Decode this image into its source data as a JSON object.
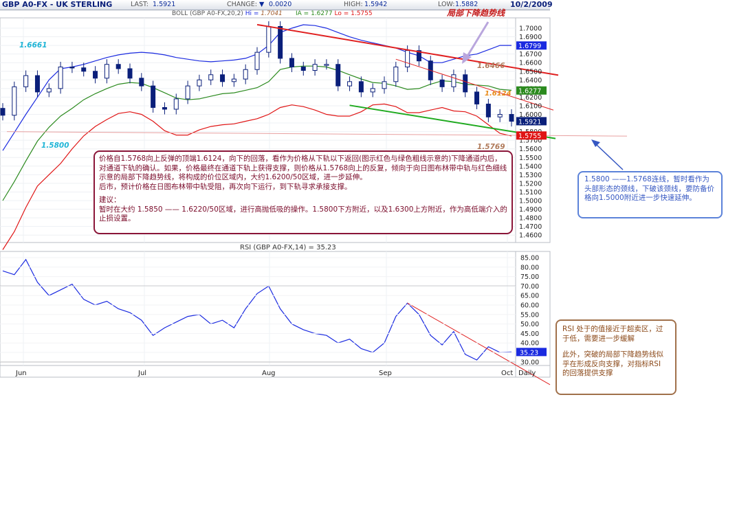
{
  "header": {
    "title": "GBP A0-FX - UK STERLING",
    "last_label": "LAST:",
    "last_value": "1.5921",
    "change_label": "CHANGE:",
    "change_arrow": "▼",
    "change_value": "0.0020",
    "high_label": "HIGH:",
    "high_value": "1.5942",
    "low_label": "LOW:",
    "low_value": "1.5882",
    "date": "10/2/2009"
  },
  "boll_legend": {
    "label": "BOLL (GBP A0-FX,20,2)",
    "hi_label": "Hi =",
    "hi_value": "1.7041",
    "ia_label": "IA =",
    "ia_value": "1.6277",
    "lo_label": "Lo =",
    "lo_value": "1.5755"
  },
  "rsi_legend": "RSI (GBP A0-FX,14) = 35.23",
  "colors": {
    "candle": "#0a1f7a",
    "upper_band": "#1a2ae0",
    "middle_band": "#2b8a1e",
    "lower_band": "#e01414",
    "trend_red": "#e02020",
    "trend_green": "#1faa1f",
    "rsi_line": "#1a2ae0",
    "annotation_title": "#c41a1a"
  },
  "chart_labels": {
    "annotation_title": "局部下降趋势线",
    "lvl_16661": "1.6661",
    "lvl_15800": "1.5800",
    "lvl_16466": "1.6466",
    "lvl_16124": "1.6124",
    "lvl_15769": "1.5769",
    "lvl_17041": "1.7041"
  },
  "tags": {
    "upper": "1.6799",
    "middle": "1.6277",
    "last": "1.5921",
    "lower": "1.5755",
    "rsi": "35.23"
  },
  "price_ticks": [
    "1.7000",
    "1.6900",
    "1.6800",
    "1.6700",
    "1.6600",
    "1.6500",
    "1.6400",
    "1.6300",
    "1.6200",
    "1.6100",
    "1.6000",
    "1.5900",
    "1.5800",
    "1.5700",
    "1.5600",
    "1.5500",
    "1.5400",
    "1.5300",
    "1.5200",
    "1.5100",
    "1.5000",
    "1.4900",
    "1.4800",
    "1.4700",
    "1.4600"
  ],
  "rsi_ticks": [
    "85.00",
    "80.00",
    "75.00",
    "70.00",
    "65.00",
    "60.00",
    "55.00",
    "50.00",
    "45.00",
    "40.00",
    "35.00",
    "30.00"
  ],
  "month_labels": [
    "Jun",
    "Jul",
    "Aug",
    "Sep",
    "Oct",
    "Daily"
  ],
  "annotations": {
    "main_p1": "价格自1.5768向上反弹的顶端1.6124，向下的回落，看作为价格从下轨以下返回(图示红色与绿色粗线示意的)下降通道内后，对通道下轨的确认。如果，价格最终在通道下轨上获得支撑，则价格从1.5768向上的反复，倾向于向日图布林带中轨与红色细线示意的局部下降趋势线，将构成的价位区域内，大约1.6200/50区域，进一步延伸。",
    "main_p2": "后市，预计价格在日图布林带中轨受阻，再次向下运行，到下轨寻求承接支撑。",
    "main_p3": "建议：",
    "main_p4": "暂时在大约 1.5850 —— 1.6220/50区域，进行高抛低吸的操作。1.5800下方附近，以及1.6300上方附近，作为高低端介入的止损设置。",
    "blue": "1.5800 ——1.5768连线，暂时看作为头部形态的颈线，下破该颈线，要防备价格向1.5000附近进一步快速延伸。",
    "brown_p1": "RSI 处于的值接近于超卖区，过于低，需要进一步缓解",
    "brown_p2": "此外，突破的局部下降趋势线似乎在形成反向支撑，对指标RSI 的回落提供支撑"
  },
  "chart_data": [
    {
      "type": "line",
      "title": "GBP A0-FX - UK STERLING",
      "subtitle": "BOLL (GBP A0-FX,20,2)",
      "x": [
        "Jun",
        "Jul",
        "Aug",
        "Sep",
        "Oct"
      ],
      "ylim": [
        1.455,
        1.705
      ],
      "series": [
        {
          "name": "Hi",
          "values": [
            1.558,
            1.579,
            1.6,
            1.62,
            1.64,
            1.653,
            1.655,
            1.658,
            1.662,
            1.666,
            1.669,
            1.671,
            1.672,
            1.671,
            1.669,
            1.666,
            1.664,
            1.662,
            1.661,
            1.662,
            1.663,
            1.665,
            1.67,
            1.68,
            1.695,
            1.7,
            1.704,
            1.703,
            1.7,
            1.695,
            1.69,
            1.686,
            1.683,
            1.68,
            1.677,
            1.672,
            1.668,
            1.66,
            1.66,
            1.664,
            1.668,
            1.67,
            1.675,
            1.68,
            1.68
          ]
        },
        {
          "name": "IA",
          "values": [
            1.5,
            1.522,
            1.546,
            1.569,
            1.585,
            1.598,
            1.607,
            1.617,
            1.624,
            1.63,
            1.635,
            1.637,
            1.636,
            1.631,
            1.625,
            1.619,
            1.617,
            1.618,
            1.621,
            1.624,
            1.625,
            1.628,
            1.631,
            1.638,
            1.652,
            1.655,
            1.656,
            1.656,
            1.655,
            1.651,
            1.646,
            1.641,
            1.637,
            1.636,
            1.633,
            1.629,
            1.63,
            1.635,
            1.639,
            1.638,
            1.635,
            1.634,
            1.633,
            1.629,
            1.628
          ]
        },
        {
          "name": "Lo",
          "values": [
            1.443,
            1.464,
            1.492,
            1.517,
            1.53,
            1.543,
            1.56,
            1.575,
            1.586,
            1.594,
            1.601,
            1.603,
            1.6,
            1.592,
            1.581,
            1.576,
            1.576,
            1.582,
            1.586,
            1.588,
            1.589,
            1.592,
            1.595,
            1.6,
            1.608,
            1.611,
            1.609,
            1.605,
            1.6,
            1.598,
            1.598,
            1.603,
            1.611,
            1.612,
            1.609,
            1.602,
            1.602,
            1.605,
            1.608,
            1.604,
            1.603,
            1.598,
            1.588,
            1.578,
            1.575
          ]
        },
        {
          "name": "Close",
          "values": [
            1.599,
            1.632,
            1.645,
            1.626,
            1.63,
            1.655,
            1.654,
            1.65,
            1.642,
            1.658,
            1.653,
            1.642,
            1.633,
            1.608,
            1.606,
            1.618,
            1.633,
            1.64,
            1.646,
            1.638,
            1.641,
            1.652,
            1.672,
            1.702,
            1.665,
            1.655,
            1.651,
            1.658,
            1.658,
            1.633,
            1.638,
            1.626,
            1.63,
            1.638,
            1.655,
            1.674,
            1.662,
            1.64,
            1.632,
            1.646,
            1.626,
            1.612,
            1.597,
            1.6,
            1.592
          ]
        }
      ],
      "levels": {
        "top": 1.7041,
        "upper_band": 1.6799,
        "middle_band": 1.6277,
        "last": 1.5921,
        "lower_band": 1.5755,
        "neckline": 1.58,
        "low": 1.5769
      }
    },
    {
      "type": "line",
      "title": "RSI (GBP A0-FX,14) = 35.23",
      "x": [
        "Jun",
        "Jul",
        "Aug",
        "Sep",
        "Oct"
      ],
      "ylim": [
        28,
        86
      ],
      "reference_lines": [
        70,
        30
      ],
      "series": [
        {
          "name": "RSI",
          "values": [
            78,
            76,
            84,
            72,
            65,
            68,
            71,
            63,
            60,
            62,
            58,
            56,
            52,
            44,
            48,
            51,
            54,
            55,
            50,
            52,
            48,
            58,
            66,
            70,
            58,
            50,
            47,
            45,
            44,
            40,
            42,
            37,
            35,
            40,
            54,
            61,
            55,
            44,
            39,
            46,
            34,
            31,
            38,
            35,
            35.23
          ]
        }
      ]
    }
  ]
}
